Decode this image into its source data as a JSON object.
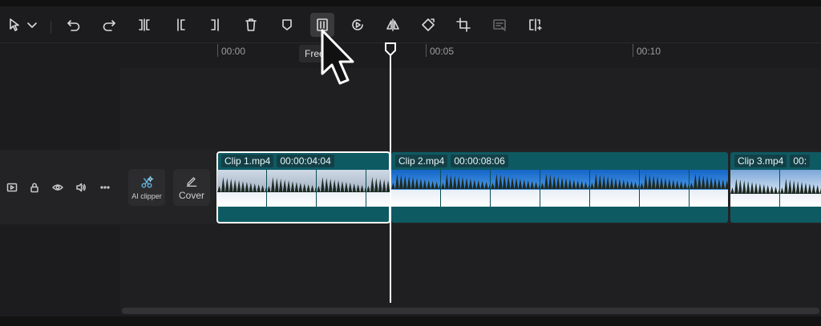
{
  "toolbar": {
    "tooltip": "Free"
  },
  "ruler": {
    "labels": [
      "00:00",
      "00:05",
      "00:10"
    ]
  },
  "side_buttons": {
    "ai_clipper": "AI clipper",
    "cover": "Cover"
  },
  "clips": [
    {
      "name": "Clip 1.mp4",
      "duration": "00:00:04:04"
    },
    {
      "name": "Clip 2.mp4",
      "duration": "00:00:08:06"
    },
    {
      "name": "Clip 3.mp4",
      "duration": "00:"
    }
  ],
  "colors": {
    "clip": "#0e5a63",
    "background": "#1c1c1e",
    "playhead": "#ffffff"
  }
}
